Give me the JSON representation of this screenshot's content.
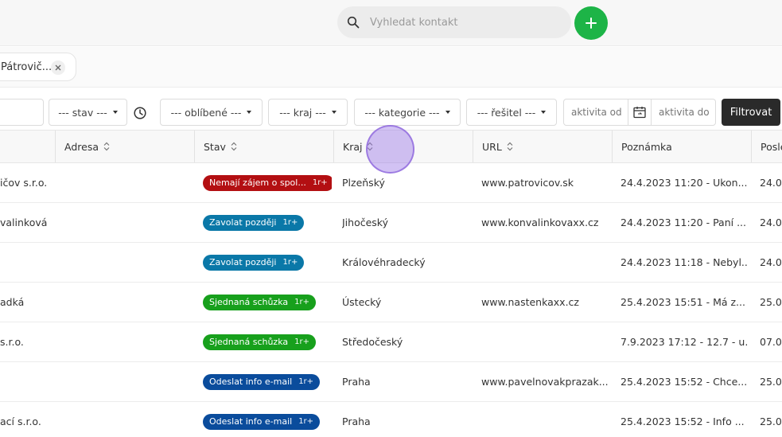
{
  "header": {
    "search_placeholder": "Vyhledat kontakt"
  },
  "tabs": {
    "open_contact": "Pátrovič..."
  },
  "filters": {
    "stav": "--- stav ---",
    "oblibene": "--- oblíbené ---",
    "kraj": "--- kraj ---",
    "kategorie": "--- kategorie ---",
    "resitel": "--- řešitel ---",
    "aktivita_od_placeholder": "aktivita od",
    "aktivita_do_placeholder": "aktivita do",
    "submit_label": "Filtrovat"
  },
  "table": {
    "headers": {
      "adresa": "Adresa",
      "stav": "Stav",
      "kraj": "Kraj",
      "url": "URL",
      "poznamka": "Poznámka",
      "posledni": "Posle"
    },
    "rows": [
      {
        "name": "ičov s.r.o.",
        "status": "Nemají zájem o spol...",
        "status_more": "1r+",
        "status_color": "#b30f12",
        "kraj": "Plzeňský",
        "url": "www.patrovicov.sk",
        "poznamka": "24.4.2023 11:20 - Ukon...",
        "posledni": "24.0"
      },
      {
        "name": "valinková",
        "status": "Zavolat později",
        "status_more": "1r+",
        "status_color": "#0a78a8",
        "kraj": "Jihočeský",
        "url": "www.konvalinkovaxx.cz",
        "poznamka": "24.4.2023 11:20 - Paní ...",
        "posledni": "24.0"
      },
      {
        "name": "",
        "status": "Zavolat později",
        "status_more": "1r+",
        "status_color": "#0a78a8",
        "kraj": "Královéhradecký",
        "url": "",
        "poznamka": "24.4.2023 11:18 - Nebyl...",
        "posledni": "24.0"
      },
      {
        "name": "adká",
        "status": "Sjednaná schůzka",
        "status_more": "1r+",
        "status_color": "#17a01c",
        "kraj": "Ústecký",
        "url": "www.nastenkaxx.cz",
        "poznamka": "25.4.2023 15:51 - Má z...",
        "posledni": "25.0"
      },
      {
        "name": "s.r.o.",
        "status": "Sjednaná schůzka",
        "status_more": "1r+",
        "status_color": "#17a01c",
        "kraj": "Středočeský",
        "url": "",
        "poznamka": "7.9.2023 17:12 - 12.7 - u...",
        "posledni": "07.09"
      },
      {
        "name": "",
        "status": "Odeslat info e-mail",
        "status_more": "1r+",
        "status_color": "#0a4c9c",
        "kraj": "Praha",
        "url": "www.pavelnovakprazak...",
        "poznamka": "25.4.2023 15:52 - Chce...",
        "posledni": "25.0"
      },
      {
        "name": "ací s.r.o.",
        "status": "Odeslat info e-mail",
        "status_more": "1r+",
        "status_color": "#0a4c9c",
        "kraj": "Praha",
        "url": "",
        "poznamka": "25.4.2023 15:52 - Info ...",
        "posledni": "25.0"
      }
    ]
  },
  "colors": {
    "accent_green": "#1db447",
    "filter_button": "#2a2a2a"
  }
}
